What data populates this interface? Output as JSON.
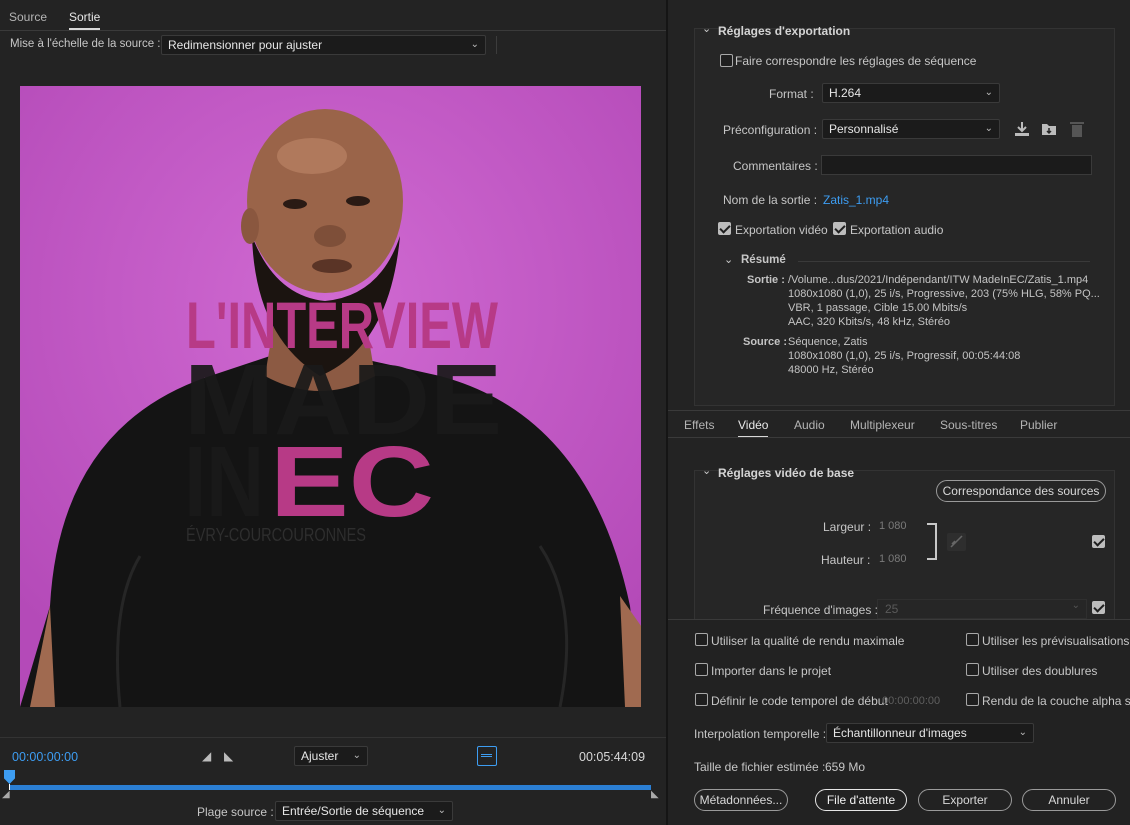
{
  "left": {
    "tabs": [
      "Source",
      "Sortie"
    ],
    "scale_label": "Mise à l'échelle de la source :",
    "scale_value": "Redimensionner pour ajuster",
    "preview": {
      "line1": "L'INTERVIEW",
      "line2": "MADE",
      "line3": "IN",
      "line3b": "EC",
      "line4": "ÉVRY-COURCOURONNES",
      "bg": "#c057c2",
      "accent": "#b73a86"
    },
    "timecode_start": "00:00:00:00",
    "timecode_end": "00:05:44:09",
    "fit_value": "Ajuster",
    "range_label": "Plage source :",
    "range_value": "Entrée/Sortie de séquence",
    "playhead_fraction": 0
  },
  "export": {
    "section_title": "Réglages d'exportation",
    "match_seq": "Faire correspondre les réglages de séquence",
    "format_label": "Format :",
    "format_value": "H.264",
    "preset_label": "Préconfiguration :",
    "preset_value": "Personnalisé",
    "comments_label": "Commentaires :",
    "output_label": "Nom de la sortie :",
    "output_value": "Zatis_1.mp4",
    "export_video": "Exportation vidéo",
    "export_audio": "Exportation audio",
    "summary_title": "Résumé",
    "output_key": "Sortie :",
    "output_lines": [
      "/Volume...dus/2021/Indépendant/ITW MadeInEC/Zatis_1.mp4",
      "1080x1080 (1,0), 25 i/s, Progressive, 203 (75% HLG, 58% PQ...",
      "VBR, 1 passage, Cible 15.00  Mbits/s",
      "AAC, 320  Kbits/s, 48  kHz, Stéréo"
    ],
    "source_key": "Source :",
    "source_lines": [
      "Séquence, Zatis",
      "1080x1080 (1,0), 25  i/s, Progressif, 00:05:44:08",
      "48000 Hz, Stéréo"
    ]
  },
  "tabs2": [
    "Effets",
    "Vidéo",
    "Audio",
    "Multiplexeur",
    "Sous-titres",
    "Publier"
  ],
  "video": {
    "section_title": "Réglages vidéo de base",
    "match_btn": "Correspondance des sources",
    "width_label": "Largeur :",
    "width_value": "1 080",
    "height_label": "Hauteur :",
    "height_value": "1 080",
    "fps_label": "Fréquence d'images :",
    "fps_value": "25"
  },
  "bottom": {
    "max_quality": "Utiliser la qualité de rendu maximale",
    "use_previews": "Utiliser les prévisualisations",
    "import_project": "Importer dans le projet",
    "use_proxies": "Utiliser des doublures",
    "set_timecode": "Définir le code temporel de début",
    "timecode_value": "00:00:00:00",
    "alpha": "Rendu de la couche alpha seule",
    "interp_label": "Interpolation temporelle :",
    "interp_value": "Échantillonneur d'images",
    "size_label": "Taille de fichier estimée :",
    "size_value": "659 Mo",
    "metadata": "Métadonnées...",
    "queue": "File d'attente",
    "export": "Exporter",
    "cancel": "Annuler"
  },
  "colors": {
    "link": "#3d9df2",
    "timecode": "#3d9df2",
    "track": "#2b7fd4"
  }
}
